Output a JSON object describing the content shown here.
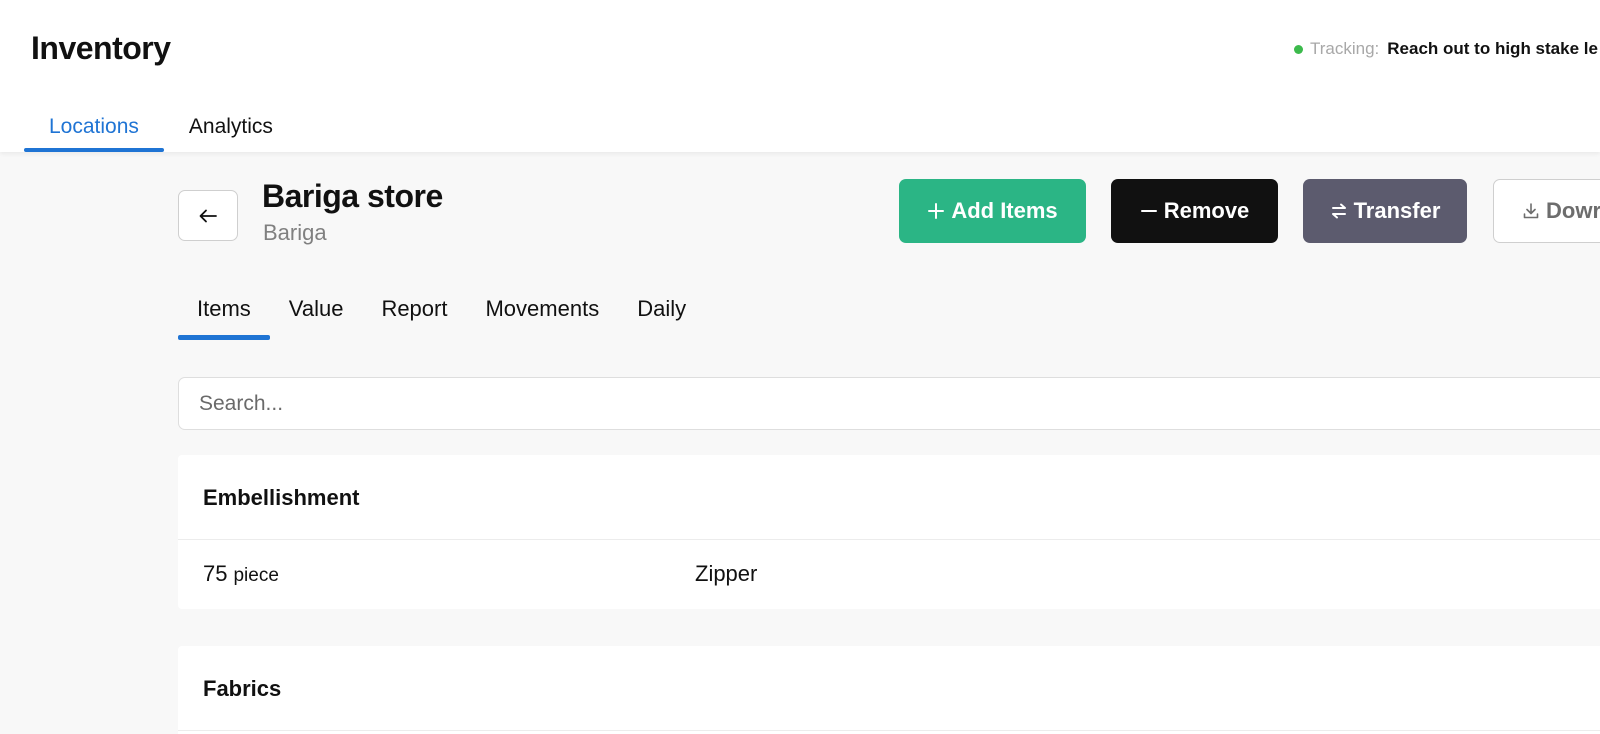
{
  "header": {
    "title": "Inventory",
    "tracking": {
      "status_color": "#3cba4c",
      "label": "Tracking:",
      "value": "Reach out to high stake le"
    },
    "tabs": [
      {
        "label": "Locations",
        "active": true
      },
      {
        "label": "Analytics",
        "active": false
      }
    ],
    "accent_color": "#1f74d4"
  },
  "store": {
    "back_icon": "arrow-left-icon",
    "name": "Bariga store",
    "location": "Bariga"
  },
  "actions": {
    "add": {
      "icon": "plus-icon",
      "label": "Add Items",
      "color": "#2bb585"
    },
    "remove": {
      "icon": "minus-icon",
      "label": "Remove",
      "color": "#111111"
    },
    "transfer": {
      "icon": "transfer-arrows-icon",
      "label": "Transfer",
      "color": "#5c5b6e"
    },
    "download": {
      "icon": "download-icon",
      "label": "Dowr"
    }
  },
  "sub_tabs": [
    {
      "label": "Items",
      "active": true
    },
    {
      "label": "Value",
      "active": false
    },
    {
      "label": "Report",
      "active": false
    },
    {
      "label": "Movements",
      "active": false
    },
    {
      "label": "Daily",
      "active": false
    }
  ],
  "search": {
    "placeholder": "Search...",
    "value": ""
  },
  "categories": [
    {
      "name": "Embellishment",
      "items": [
        {
          "quantity": "75",
          "unit": "piece",
          "name": "Zipper"
        }
      ]
    },
    {
      "name": "Fabrics",
      "items": []
    }
  ]
}
